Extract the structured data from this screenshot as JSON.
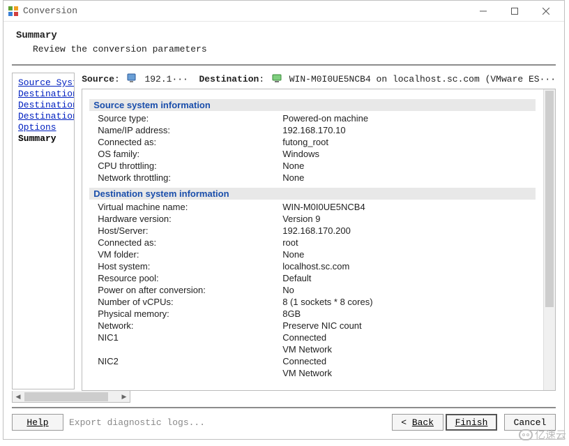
{
  "window": {
    "title": "Conversion"
  },
  "page_head": {
    "title": "Summary",
    "subtitle": "Review the conversion parameters"
  },
  "nav": {
    "items": [
      {
        "label": "Source System",
        "current": false
      },
      {
        "label": "Destination System",
        "current": false
      },
      {
        "label": "Destination Virtual Machine",
        "current": false
      },
      {
        "label": "Destination Location",
        "current": false
      },
      {
        "label": "Options",
        "current": false
      },
      {
        "label": "Summary",
        "current": true
      }
    ]
  },
  "srcdest": {
    "source_label": "Source",
    "source_value": "192.1···",
    "dest_label": "Destination",
    "dest_value": "WIN-M0I0UE5NCB4 on localhost.sc.com (VMware ES···"
  },
  "sections": [
    {
      "title": "Source system information",
      "rows": [
        {
          "k": "Source type:",
          "v": "Powered-on machine"
        },
        {
          "k": "Name/IP address:",
          "v": "192.168.170.10"
        },
        {
          "k": "Connected as:",
          "v": "futong_root"
        },
        {
          "k": "OS family:",
          "v": "Windows"
        },
        {
          "k": "CPU throttling:",
          "v": "None"
        },
        {
          "k": "Network throttling:",
          "v": "None"
        }
      ]
    },
    {
      "title": "Destination system information",
      "rows": [
        {
          "k": "Virtual machine name:",
          "v": "WIN-M0I0UE5NCB4"
        },
        {
          "k": "Hardware version:",
          "v": "Version 9"
        },
        {
          "k": "Host/Server:",
          "v": "192.168.170.200"
        },
        {
          "k": "Connected as:",
          "v": "root"
        },
        {
          "k": "VM folder:",
          "v": "None"
        },
        {
          "k": "Host system:",
          "v": "localhost.sc.com"
        },
        {
          "k": "Resource pool:",
          "v": "Default"
        },
        {
          "k": "Power on after conversion:",
          "v": "No"
        },
        {
          "k": "Number of vCPUs:",
          "v": "8 (1 sockets * 8 cores)"
        },
        {
          "k": "Physical memory:",
          "v": "8GB"
        },
        {
          "k": "Network:",
          "v": "Preserve NIC count"
        },
        {
          "k": "NIC1",
          "v": "Connected"
        },
        {
          "k": "",
          "v": "VM Network"
        },
        {
          "k": "NIC2",
          "v": "Connected"
        },
        {
          "k": "",
          "v": "VM Network"
        }
      ]
    }
  ],
  "footer": {
    "help": "Help",
    "export_text": "Export diagnostic logs...",
    "back": "Back",
    "finish": "Finish",
    "cancel": "Cancel"
  },
  "watermark": "亿速云"
}
